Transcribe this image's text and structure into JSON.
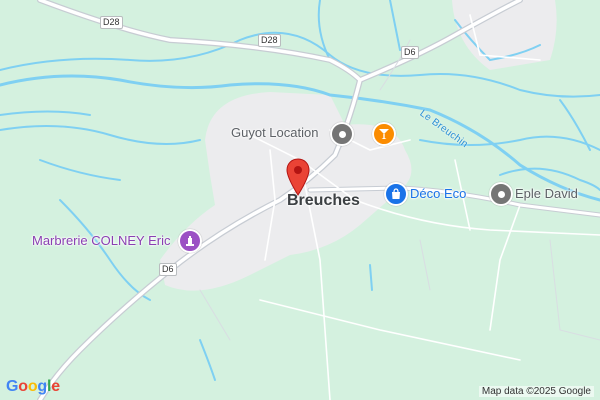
{
  "map": {
    "town_name": "Breuches",
    "river_name": "Le Breuchin",
    "road_labels": [
      "D28",
      "D28",
      "D6",
      "D6"
    ],
    "places": [
      {
        "name": "Guyot Location",
        "icon": "circle-poi-icon",
        "color": "#757575"
      },
      {
        "name": "Déco Eco",
        "icon": "shopping-bag-icon",
        "color": "#1a73e8"
      },
      {
        "name": "Eple David",
        "icon": "circle-poi-icon",
        "color": "#757575"
      },
      {
        "name": "Marbrerie COLNEY Eric",
        "icon": "monument-icon",
        "color": "#9b51c4"
      }
    ],
    "bar_icon": "cocktail-icon",
    "marker_icon": "red-location-marker-icon",
    "attribution": "Map data ©2025 Google",
    "logo_letters": [
      "G",
      "o",
      "o",
      "g",
      "l",
      "e"
    ],
    "logo_colors": [
      "#4285f4",
      "#ea4335",
      "#fbbc05",
      "#4285f4",
      "#34a853",
      "#ea4335"
    ]
  }
}
